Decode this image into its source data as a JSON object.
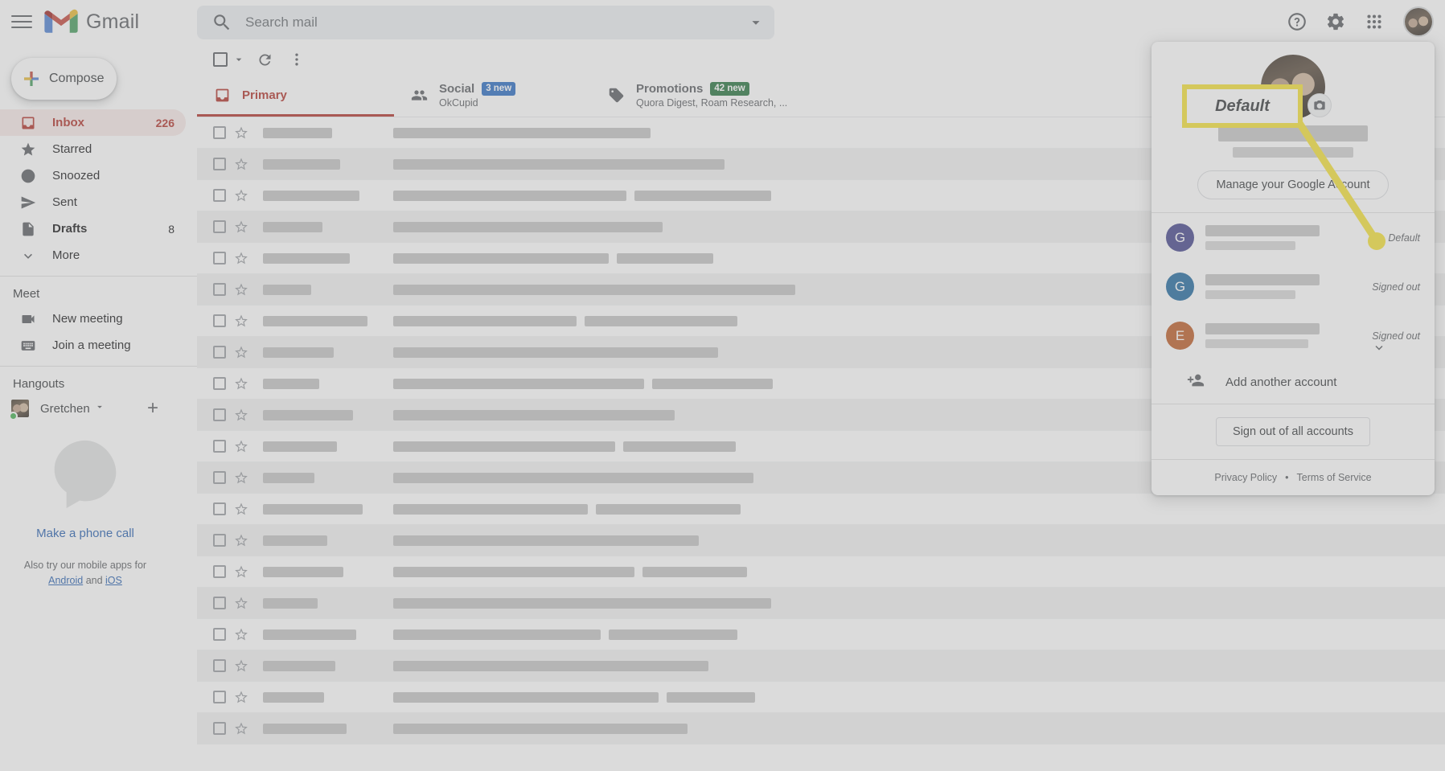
{
  "header": {
    "app_name": "Gmail",
    "menu_icon": "hamburger-icon",
    "search": {
      "placeholder": "Search mail",
      "value": "",
      "search_icon": "search-icon",
      "options_icon": "chevron-down-icon"
    },
    "help_icon": "help-icon",
    "settings_icon": "gear-icon",
    "apps_icon": "google-apps-grid-icon",
    "avatar": "account-avatar"
  },
  "sidebar": {
    "compose": {
      "label": "Compose",
      "icon": "plus-icon"
    },
    "items": [
      {
        "label": "Inbox",
        "count": "226",
        "icon": "inbox-icon",
        "active": true,
        "bold": false
      },
      {
        "label": "Starred",
        "count": "",
        "icon": "star-icon",
        "active": false,
        "bold": false
      },
      {
        "label": "Snoozed",
        "count": "",
        "icon": "clock-icon",
        "active": false,
        "bold": false
      },
      {
        "label": "Sent",
        "count": "",
        "icon": "send-icon",
        "active": false,
        "bold": false
      },
      {
        "label": "Drafts",
        "count": "8",
        "icon": "draft-icon",
        "active": false,
        "bold": true
      },
      {
        "label": "More",
        "count": "",
        "icon": "chevron-down-icon",
        "active": false,
        "bold": false
      }
    ],
    "meet": {
      "title": "Meet",
      "items": [
        {
          "label": "New meeting",
          "icon": "video-camera-icon"
        },
        {
          "label": "Join a meeting",
          "icon": "keyboard-icon"
        }
      ]
    },
    "hangouts": {
      "title": "Hangouts",
      "user": "Gretchen",
      "status_dot": "online-status-dot",
      "caret_icon": "chevron-down-icon",
      "add_icon": "plus-icon"
    },
    "phone": {
      "icon": "phone-bubble-icon",
      "link": "Make a phone call",
      "note_prefix": "Also try our mobile apps for ",
      "android": "Android",
      "note_mid": " and ",
      "ios": "iOS"
    }
  },
  "toolbar": {
    "select_all": "select-all-checkbox",
    "select_caret": "chevron-down-icon",
    "refresh": "refresh-icon",
    "more": "more-vertical-icon"
  },
  "tabs": [
    {
      "label": "Primary",
      "icon": "inbox-icon",
      "badge": "",
      "badge_color": "",
      "subtitle": "",
      "active": true
    },
    {
      "label": "Social",
      "icon": "people-icon",
      "badge": "3 new",
      "badge_color": "#1a73e8",
      "subtitle": "OkCupid",
      "active": false
    },
    {
      "label": "Promotions",
      "icon": "tag-icon",
      "badge": "42 new",
      "badge_color": "#188038",
      "subtitle": "Quora Digest, Roam Research, ...",
      "active": false
    }
  ],
  "popup": {
    "avatar": "account-avatar-large",
    "camera_icon": "camera-icon",
    "manage_button": "Manage your Google Account",
    "accounts": [
      {
        "initial": "G",
        "color": "#4a4aa8",
        "status": "Default"
      },
      {
        "initial": "G",
        "color": "#1273ba",
        "status": "Signed out"
      },
      {
        "initial": "E",
        "color": "#dd5c14",
        "status": "Signed out"
      }
    ],
    "expand_icon": "chevron-down-icon",
    "add_account": {
      "label": "Add another account",
      "icon": "person-add-icon"
    },
    "sign_out_all": "Sign out of all accounts",
    "footer": {
      "privacy": "Privacy Policy",
      "separator": "•",
      "terms": "Terms of Service"
    }
  },
  "annotation": {
    "callout_text": "Default",
    "highlight_color": "#ffe600"
  },
  "mail_rows": [
    {
      "alt": false,
      "sender_w": 86,
      "blocks": [
        320,
        0,
        0
      ]
    },
    {
      "alt": true,
      "sender_w": 96,
      "blocks": [
        412,
        0,
        0
      ]
    },
    {
      "alt": false,
      "sender_w": 120,
      "blocks": [
        290,
        170,
        0
      ]
    },
    {
      "alt": true,
      "sender_w": 74,
      "blocks": [
        335,
        0,
        0
      ]
    },
    {
      "alt": false,
      "sender_w": 108,
      "blocks": [
        268,
        120,
        0
      ]
    },
    {
      "alt": true,
      "sender_w": 60,
      "blocks": [
        500,
        0,
        0
      ]
    },
    {
      "alt": false,
      "sender_w": 130,
      "blocks": [
        228,
        190,
        0
      ]
    },
    {
      "alt": true,
      "sender_w": 88,
      "blocks": [
        404,
        0,
        0
      ]
    },
    {
      "alt": false,
      "sender_w": 70,
      "blocks": [
        312,
        150,
        0
      ]
    },
    {
      "alt": true,
      "sender_w": 112,
      "blocks": [
        350,
        0,
        0
      ]
    },
    {
      "alt": false,
      "sender_w": 92,
      "blocks": [
        276,
        140,
        0
      ]
    },
    {
      "alt": true,
      "sender_w": 64,
      "blocks": [
        448,
        0,
        0
      ]
    },
    {
      "alt": false,
      "sender_w": 124,
      "blocks": [
        242,
        180,
        0
      ]
    },
    {
      "alt": true,
      "sender_w": 80,
      "blocks": [
        380,
        0,
        0
      ]
    },
    {
      "alt": false,
      "sender_w": 100,
      "blocks": [
        300,
        130,
        0
      ]
    },
    {
      "alt": true,
      "sender_w": 68,
      "blocks": [
        470,
        0,
        0
      ]
    },
    {
      "alt": false,
      "sender_w": 116,
      "blocks": [
        258,
        160,
        0
      ]
    },
    {
      "alt": true,
      "sender_w": 90,
      "blocks": [
        392,
        0,
        0
      ]
    },
    {
      "alt": false,
      "sender_w": 76,
      "blocks": [
        330,
        110,
        0
      ]
    },
    {
      "alt": true,
      "sender_w": 104,
      "blocks": [
        366,
        0,
        0
      ]
    }
  ]
}
